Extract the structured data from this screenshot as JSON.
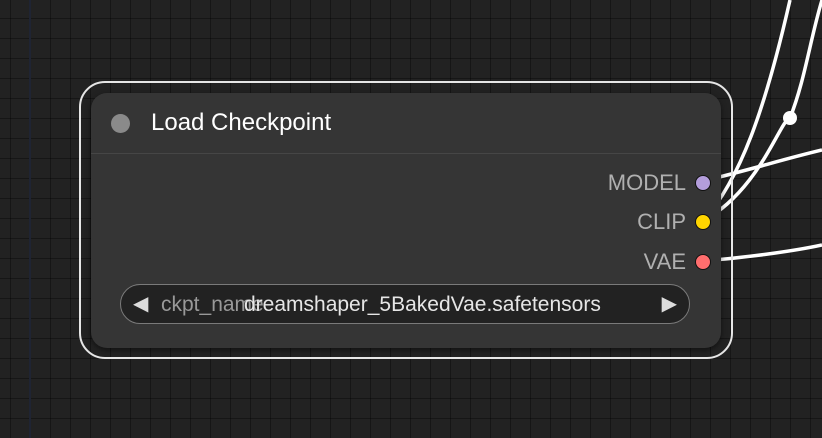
{
  "node": {
    "title": "Load Checkpoint",
    "outputs": [
      {
        "label": "MODEL",
        "color": "#b39ddb"
      },
      {
        "label": "CLIP",
        "color": "#ffd500"
      },
      {
        "label": "VAE",
        "color": "#ff6e6e"
      }
    ],
    "widget": {
      "name": "ckpt_name",
      "value": "dreamshaper_5BakedVae.safetensors",
      "left_arrow": "◀",
      "right_arrow": "▶"
    }
  },
  "colors": {
    "canvas_bg": "#222222",
    "node_bg": "#353535",
    "link": "#ffffff",
    "selection_outline": "#e6e6e6"
  }
}
